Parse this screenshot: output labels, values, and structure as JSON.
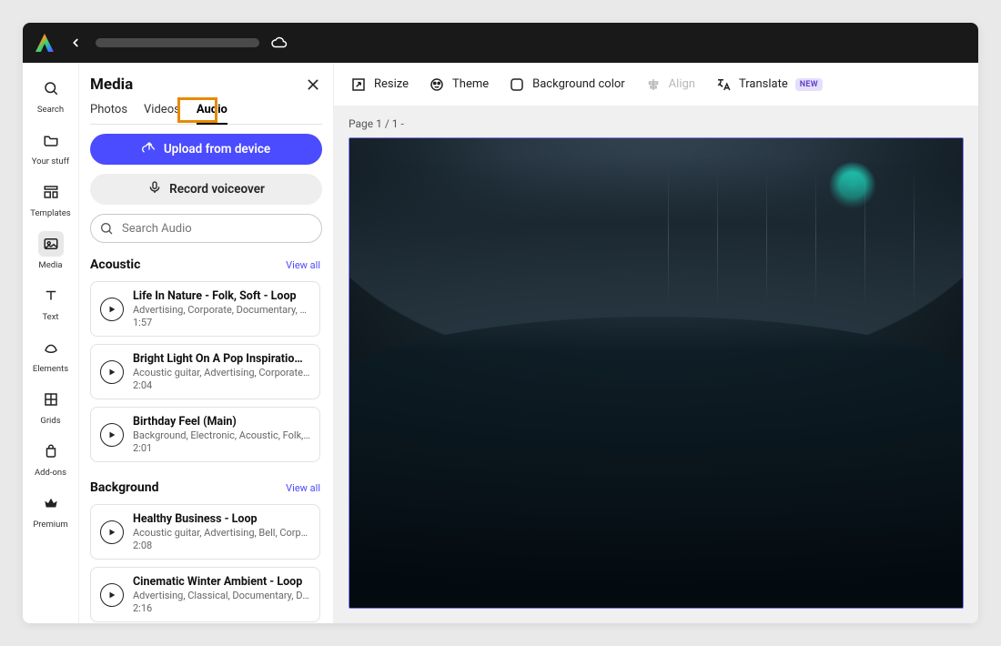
{
  "rail": {
    "items": [
      {
        "id": "search",
        "label": "Search"
      },
      {
        "id": "your-stuff",
        "label": "Your stuff"
      },
      {
        "id": "templates",
        "label": "Templates"
      },
      {
        "id": "media",
        "label": "Media"
      },
      {
        "id": "text",
        "label": "Text"
      },
      {
        "id": "elements",
        "label": "Elements"
      },
      {
        "id": "grids",
        "label": "Grids"
      },
      {
        "id": "addons",
        "label": "Add-ons"
      },
      {
        "id": "premium",
        "label": "Premium"
      }
    ]
  },
  "panel": {
    "title": "Media",
    "tabs": [
      "Photos",
      "Videos",
      "Audio"
    ],
    "active_tab": "Audio",
    "upload_label": "Upload from device",
    "record_label": "Record voiceover",
    "search_placeholder": "Search Audio",
    "sections": [
      {
        "title": "Acoustic",
        "view_all": "View all",
        "tracks": [
          {
            "title": "Life In Nature - Folk, Soft - Loop",
            "tags": "Advertising, Corporate, Documentary, D…",
            "duration": "1:57"
          },
          {
            "title": "Bright Light On A Pop Inspiratio…",
            "tags": "Acoustic guitar, Advertising, Corporate, …",
            "duration": "2:04"
          },
          {
            "title": "Birthday Feel (Main)",
            "tags": "Background, Electronic, Acoustic, Folk, …",
            "duration": "2:01"
          }
        ]
      },
      {
        "title": "Background",
        "view_all": "View all",
        "tracks": [
          {
            "title": "Healthy Business - Loop",
            "tags": "Acoustic guitar, Advertising, Bell, Corpor…",
            "duration": "2:08"
          },
          {
            "title": "Cinematic Winter Ambient - Loop",
            "tags": "Advertising, Classical, Documentary, Dr…",
            "duration": "2:16"
          }
        ]
      }
    ]
  },
  "toolbar": {
    "resize": "Resize",
    "theme": "Theme",
    "bgcolor": "Background color",
    "align": "Align",
    "translate": "Translate",
    "translate_badge": "NEW"
  },
  "stage": {
    "page_label": "Page 1 / 1 -"
  }
}
